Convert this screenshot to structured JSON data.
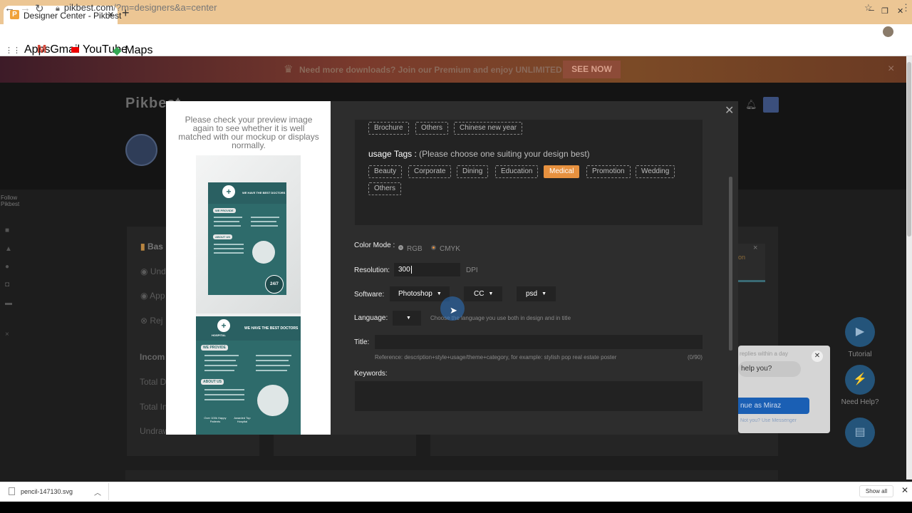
{
  "browser": {
    "tab_title": "Designer Center - Pikbest",
    "favicon_letter": "P",
    "url_host": "pikbest.com",
    "url_path": "/?m=designers&a=center",
    "bookmarks": [
      "Apps",
      "Gmail",
      "YouTube",
      "Maps"
    ]
  },
  "promo": {
    "message": "Need more downloads? Join our Premium and enjoy UNLIMITED download.",
    "button": "SEE NOW"
  },
  "site": {
    "logo": "Pikbest",
    "follow": "Follow Pikbest",
    "background_texts": {
      "basic": "Bas",
      "under": "Unde",
      "approved": "App",
      "rejected": "Rej",
      "income": "Incom",
      "total_d": "Total D",
      "total_i": "Total In",
      "undraw": "Undraw",
      "on": "on"
    }
  },
  "modal": {
    "preview_note": "Please check your preview image again to see whether it is well matched with our mockup or displays normally.",
    "category_tags": [
      "Brochure",
      "Others",
      "Chinese new year"
    ],
    "usage_title": "usage Tags :",
    "usage_hint": "(Please choose one suiting your design best)",
    "usage_tags": [
      "Beauty",
      "Corporate",
      "Dining",
      "Education",
      "Medical",
      "Promotion",
      "Wedding",
      "Others"
    ],
    "active_usage_tag": "Medical",
    "color_mode": {
      "label": "Color Mode :",
      "options": [
        "RGB",
        "CMYK"
      ],
      "selected": "CMYK"
    },
    "resolution": {
      "label": "Resolution:",
      "value": "300",
      "unit": "DPI"
    },
    "software": {
      "label": "Software:",
      "name": "Photoshop",
      "version": "CC",
      "format": "psd"
    },
    "language": {
      "label": "Language:",
      "value": "",
      "hint": "Choose the language you use both in design and in title"
    },
    "title": {
      "label": "Title:",
      "value": "",
      "reference": "Reference: description+style+usage/theme+category, for example: stylish pop real estate poster",
      "counter": "(0/90)"
    },
    "keywords": {
      "label": "Keywords:",
      "value": ""
    }
  },
  "flyer": {
    "brand": "HOSPITAL",
    "brand_sub": "Logo here",
    "headline": "WE HAVE THE BEST DOCTORS",
    "section1": "WE PROVIDE",
    "section2": "ABOUT US",
    "stat1": "Over 100k Happy Patients",
    "stat2": "Awarded Top Hospital",
    "badge": "24/7"
  },
  "widgets": {
    "chat_small": "replies within a day",
    "chat_bubble": "help you?",
    "continue_as": "nue as Miraz",
    "not_you": "Not you? Use Messenger",
    "tutorial": "Tutorial",
    "need_help": "Need Help?"
  },
  "downloads": {
    "file": "pencil-147130.svg",
    "show_all": "Show all"
  },
  "colors": {
    "accent": "#e7913f",
    "promo_button": "#8d4b38",
    "widget": "#24547a"
  }
}
